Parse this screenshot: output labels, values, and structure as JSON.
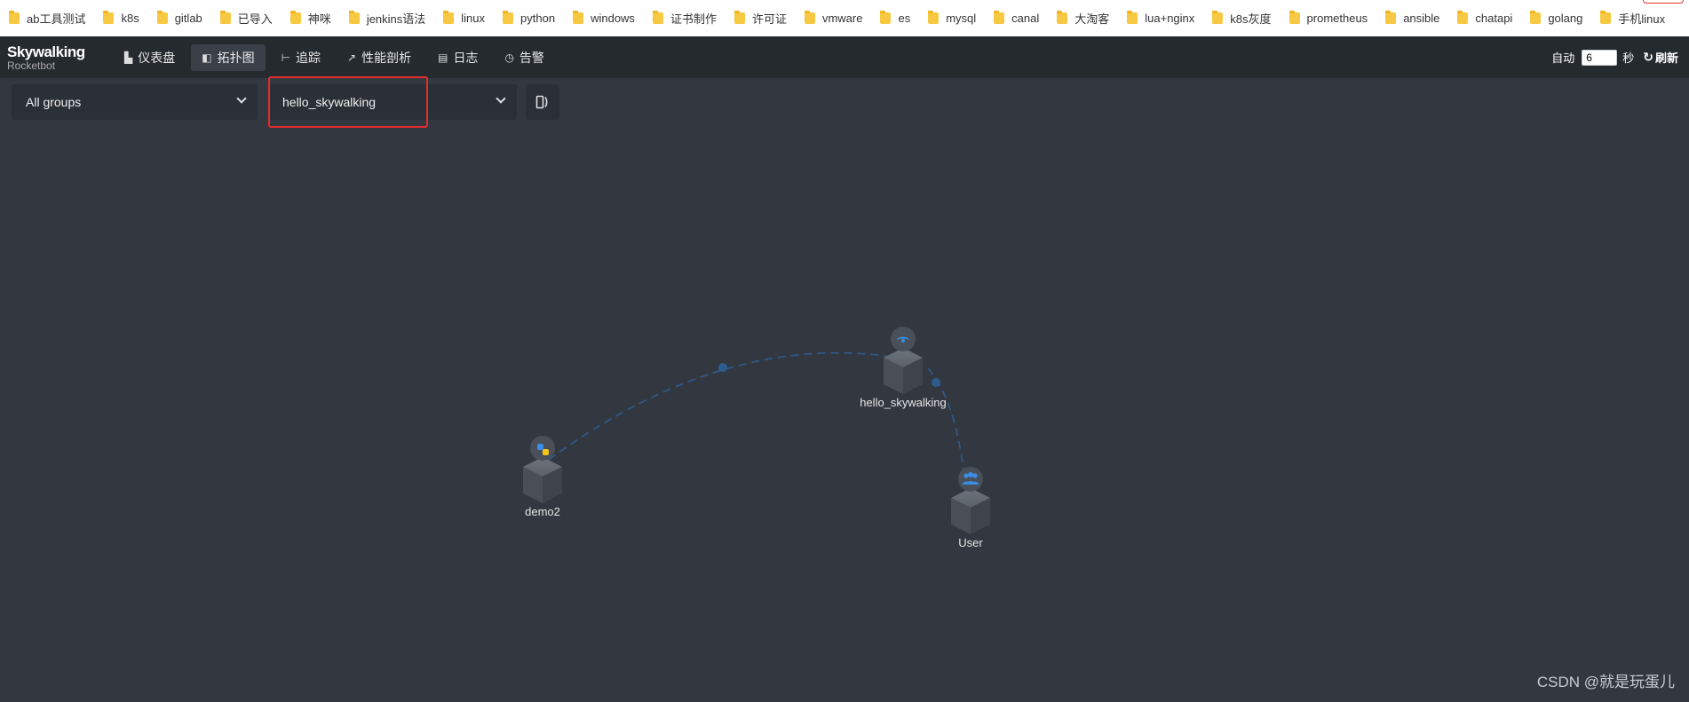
{
  "bookmarks": [
    "ab工具测试",
    "k8s",
    "gitlab",
    "已导入",
    "神咪",
    "jenkins语法",
    "linux",
    "python",
    "windows",
    "证书制作",
    "许可证",
    "vmware",
    "es",
    "mysql",
    "canal",
    "大淘客",
    "lua+nginx",
    "k8s灰度",
    "prometheus",
    "ansible",
    "chatapi",
    "golang",
    "手机linux"
  ],
  "logo": {
    "main": "Skywalking",
    "sub": "Rocketbot"
  },
  "nav": [
    {
      "label": "仪表盘",
      "icon": "dashboard-icon",
      "glyph": "▙",
      "active": false
    },
    {
      "label": "拓扑图",
      "icon": "topology-icon",
      "glyph": "◧",
      "active": true
    },
    {
      "label": "追踪",
      "icon": "trace-icon",
      "glyph": "⊢",
      "active": false
    },
    {
      "label": "性能剖析",
      "icon": "profile-icon",
      "glyph": "↗",
      "active": false
    },
    {
      "label": "日志",
      "icon": "log-icon",
      "glyph": "▤",
      "active": false
    },
    {
      "label": "告警",
      "icon": "alarm-icon",
      "glyph": "◷",
      "active": false
    }
  ],
  "header_right": {
    "auto_label": "自动",
    "interval": "6",
    "unit": "秒",
    "refresh_label": "刷新"
  },
  "toolbar": {
    "group_select": "All groups",
    "service_select": "hello_skywalking"
  },
  "topology": {
    "nodes": [
      {
        "name": "hello_skywalking",
        "badge": "skywalking-icon"
      },
      {
        "name": "demo2",
        "badge": "python-icon"
      },
      {
        "name": "User",
        "badge": "users-icon"
      }
    ],
    "edges": [
      {
        "from": "demo2",
        "to": "hello_skywalking"
      },
      {
        "from": "hello_skywalking",
        "to": "User"
      }
    ]
  },
  "watermark": "CSDN @就是玩蛋儿",
  "colors": {
    "background": "#333840",
    "navbar": "#252a2f",
    "edge": "#2d5c8f",
    "highlight": "#e32b2b",
    "node_badge_blue": "#3a8ee6"
  }
}
